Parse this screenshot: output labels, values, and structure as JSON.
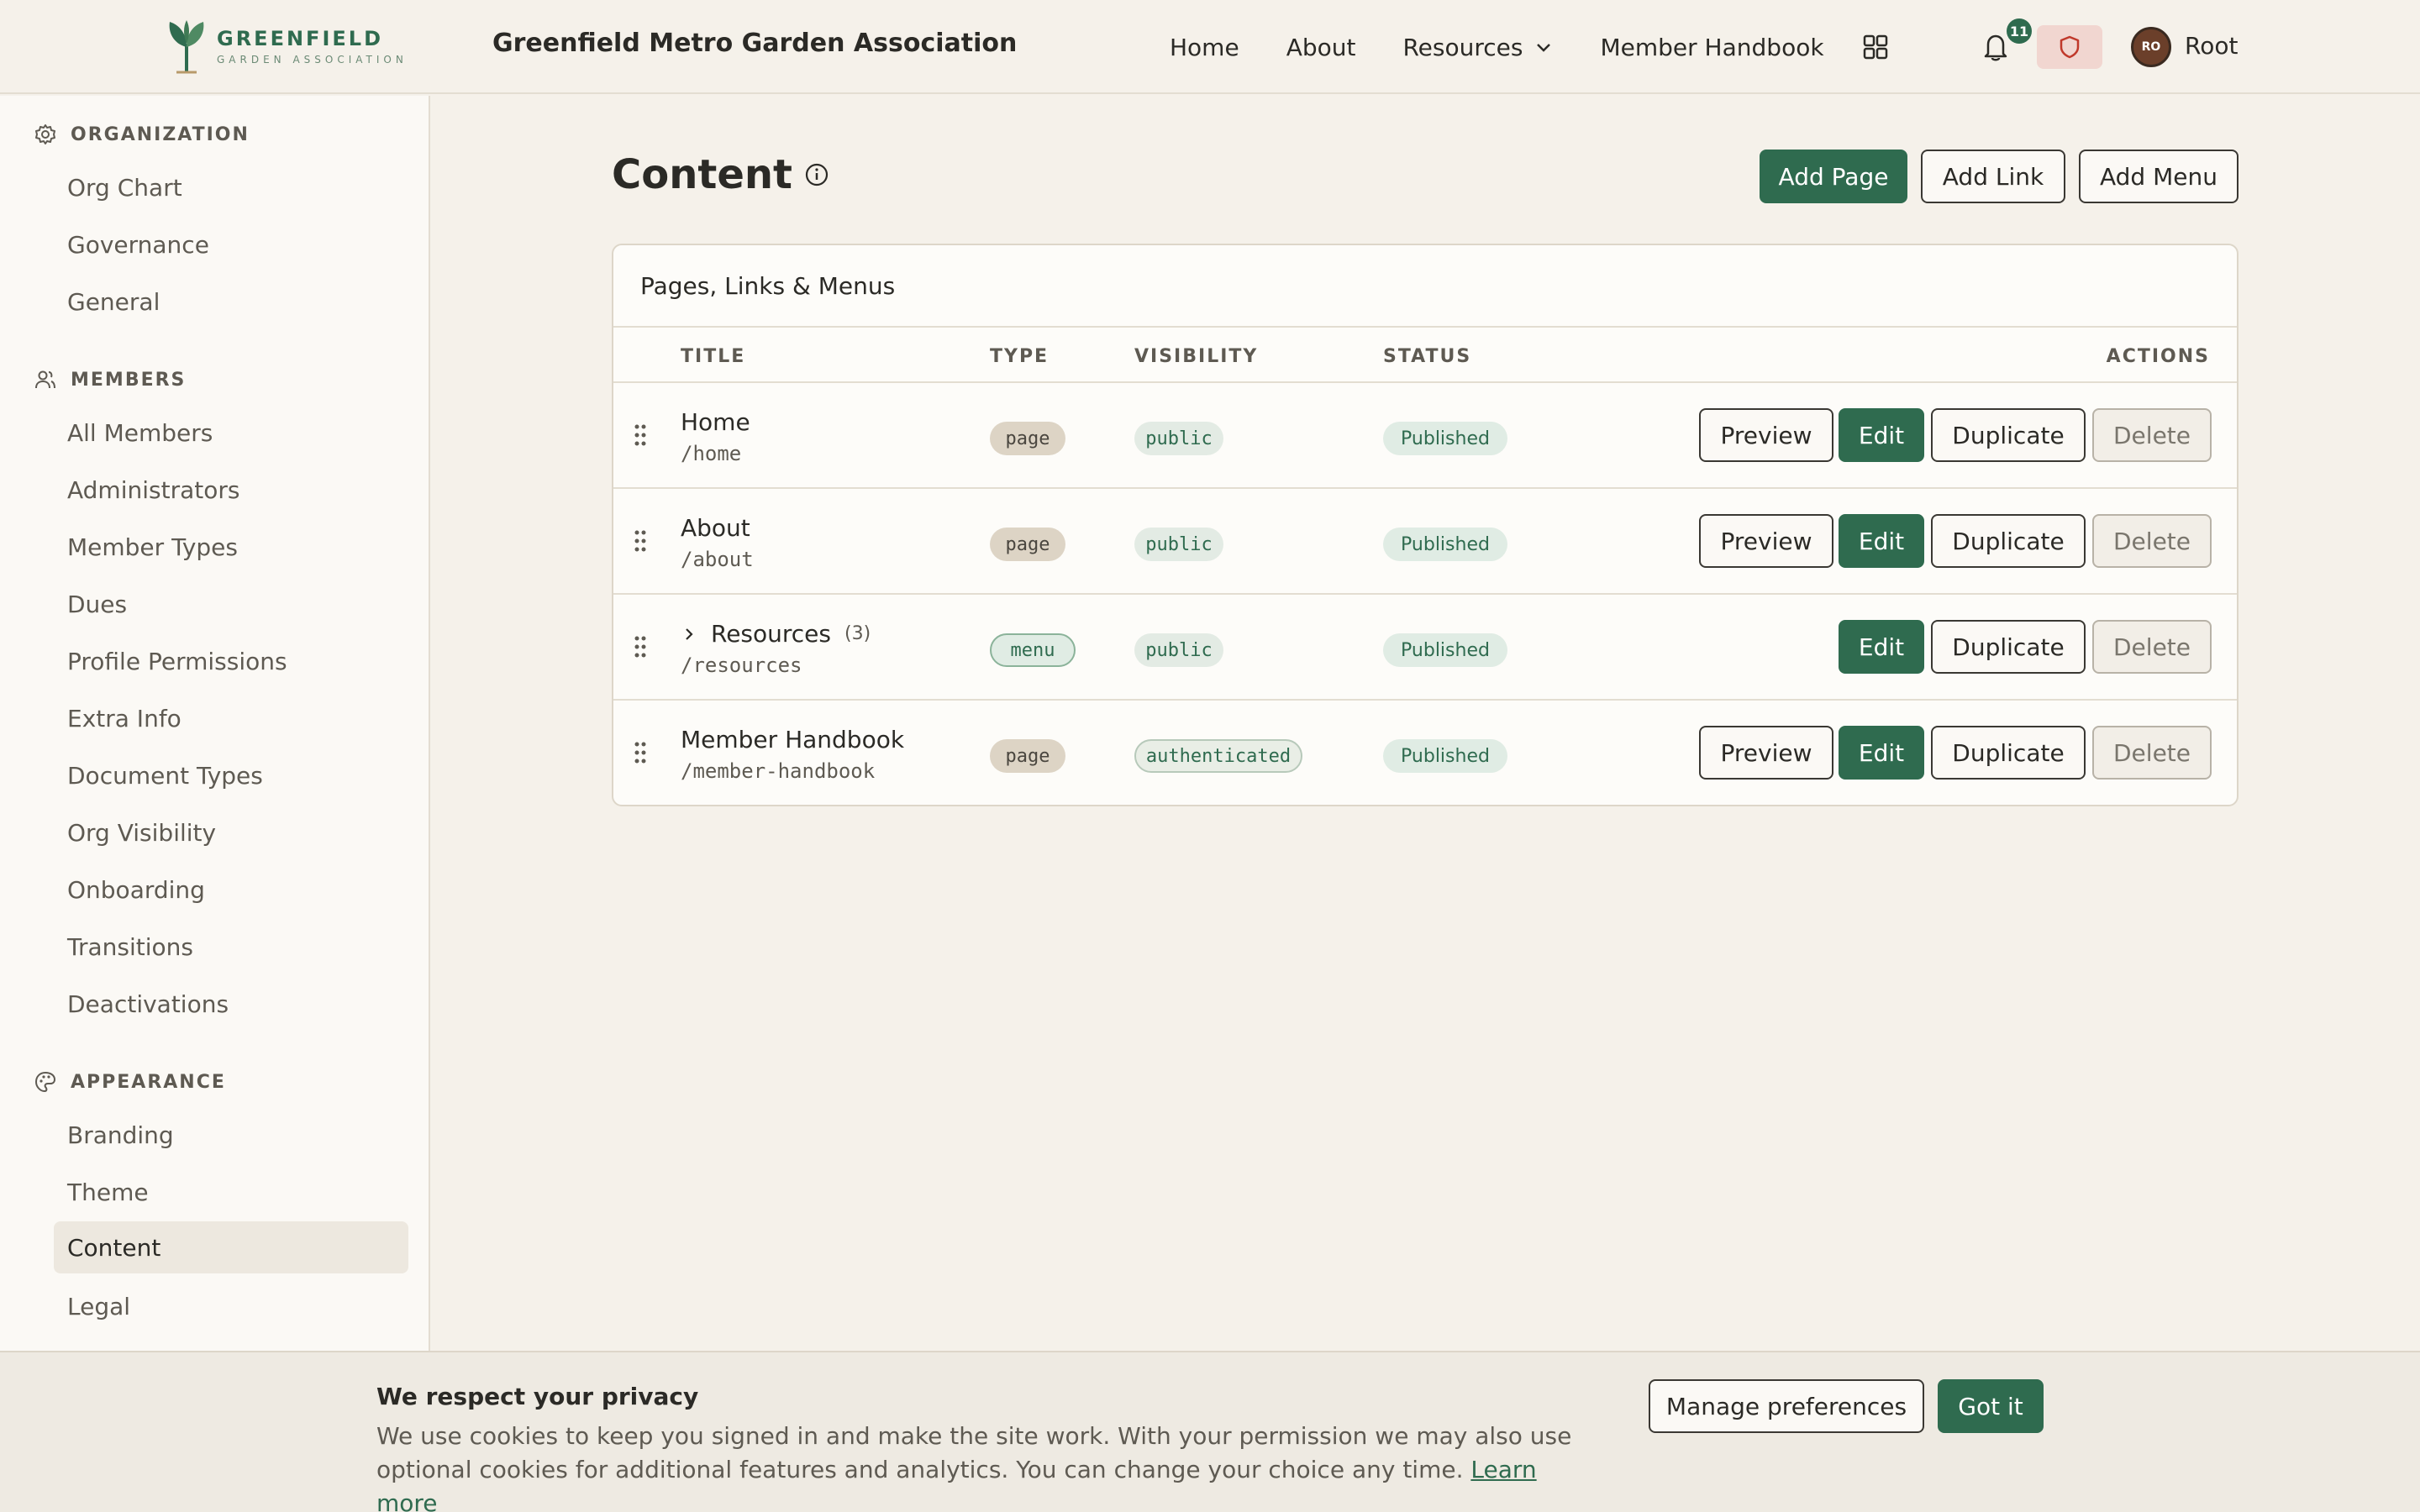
{
  "brand": {
    "logo_main": "GREENFIELD",
    "logo_sub": "GARDEN ASSOCIATION",
    "org_title": "Greenfield Metro Garden Association",
    "accent": "#2f6b4f"
  },
  "nav": {
    "items": [
      "Home",
      "About",
      "Resources",
      "Member Handbook"
    ],
    "notification_count": "11",
    "user_initials": "RO",
    "user_name": "Root"
  },
  "sidebar": {
    "sections": [
      {
        "label": "ORGANIZATION",
        "icon": "gear-icon",
        "items": [
          "Org Chart",
          "Governance",
          "General"
        ]
      },
      {
        "label": "MEMBERS",
        "icon": "users-icon",
        "items": [
          "All Members",
          "Administrators",
          "Member Types",
          "Dues",
          "Profile Permissions",
          "Extra Info",
          "Document Types",
          "Org Visibility",
          "Onboarding",
          "Transitions",
          "Deactivations"
        ]
      },
      {
        "label": "APPEARANCE",
        "icon": "palette-icon",
        "items": [
          "Branding",
          "Theme",
          "Content",
          "Legal"
        ]
      }
    ],
    "active": "Content"
  },
  "main": {
    "title": "Content",
    "actions": [
      "Add Page",
      "Add Link",
      "Add Menu"
    ],
    "panel_title": "Pages, Links & Menus",
    "columns": [
      "TITLE",
      "TYPE",
      "VISIBILITY",
      "STATUS",
      "ACTIONS"
    ],
    "rows": [
      {
        "title": "Home",
        "path": "/home",
        "type": "page",
        "visibility": "public",
        "status": "Published"
      },
      {
        "title": "About",
        "path": "/about",
        "type": "page",
        "visibility": "public",
        "status": "Published"
      },
      {
        "title": "Resources",
        "count": "(3)",
        "path": "/resources",
        "type": "menu",
        "visibility": "public",
        "status": "Published"
      },
      {
        "title": "Member Handbook",
        "path": "/member-handbook",
        "type": "page",
        "visibility": "authenticated",
        "status": "Published"
      }
    ],
    "row_actions": {
      "preview": "Preview",
      "edit": "Edit",
      "duplicate": "Duplicate",
      "delete": "Delete"
    }
  },
  "cookie": {
    "title": "We respect your privacy",
    "text": "We use cookies to keep you signed in and make the site work. With your permission we may also use optional cookies for additional features and analytics. You can change your choice any time.",
    "link": "Learn more",
    "manage": "Manage preferences",
    "accept": "Got it"
  }
}
